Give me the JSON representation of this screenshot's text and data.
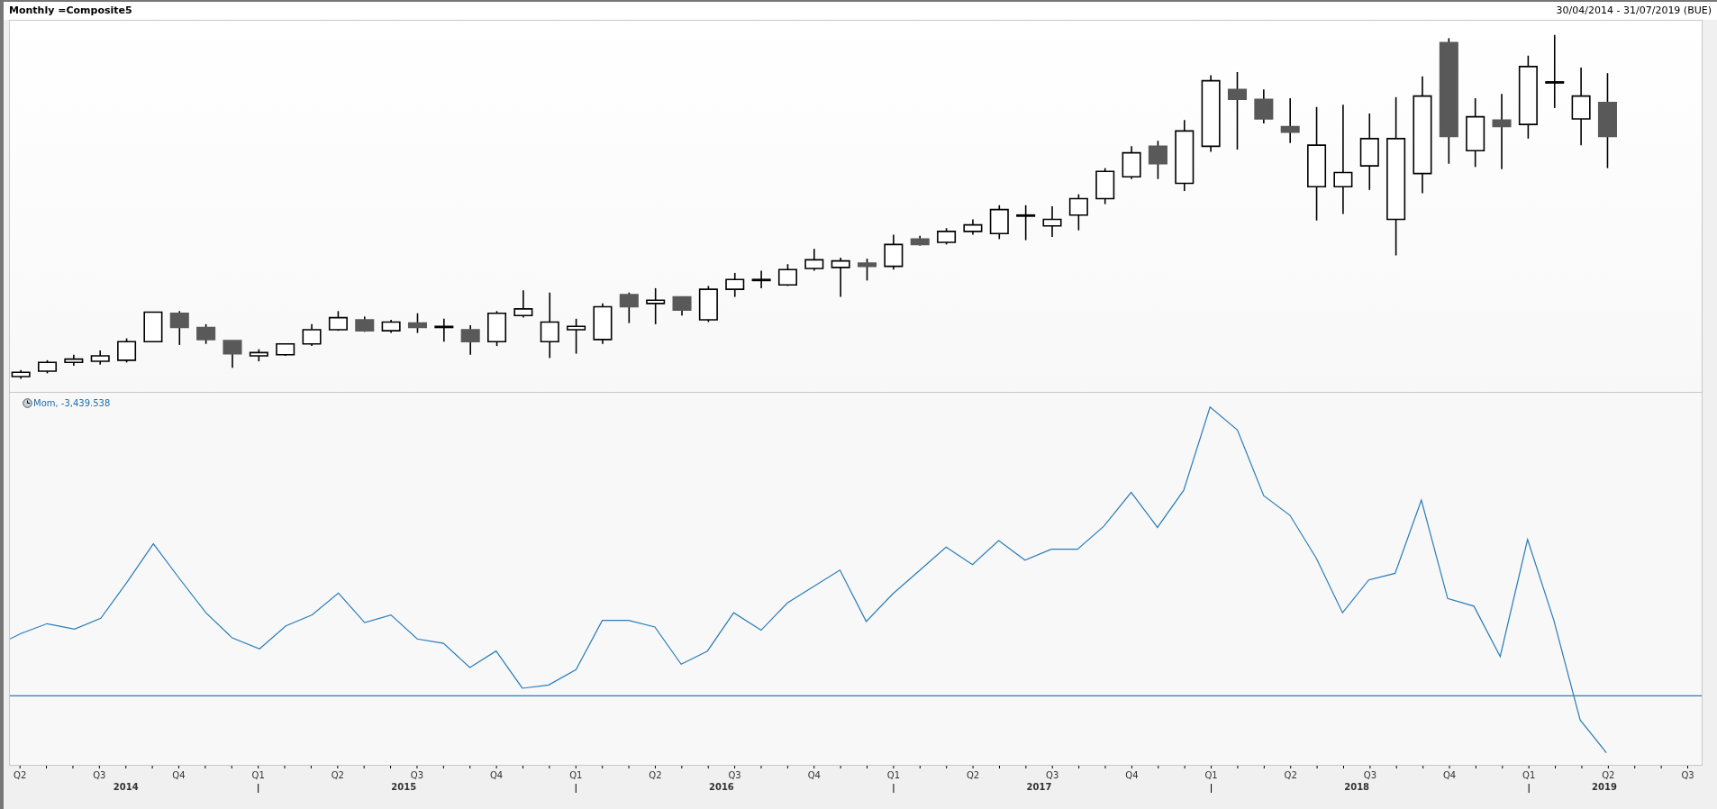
{
  "header": {
    "title": "Monthly =Composite5",
    "date_range": "30/04/2014 - 31/07/2019 (BUE)"
  },
  "indicator_panel": {
    "label": "Mom, -3,439.538"
  },
  "time_axis": {
    "quarters": [
      "Q2",
      "Q3",
      "Q4",
      "Q1",
      "Q2",
      "Q3",
      "Q4",
      "Q1",
      "Q2",
      "Q3",
      "Q4",
      "Q1",
      "Q2",
      "Q3",
      "Q4",
      "Q1",
      "Q2",
      "Q3",
      "Q4",
      "Q1",
      "Q2",
      "Q3"
    ],
    "years": [
      "2014",
      "2015",
      "2016",
      "2017",
      "2018",
      "2019"
    ]
  }
}
